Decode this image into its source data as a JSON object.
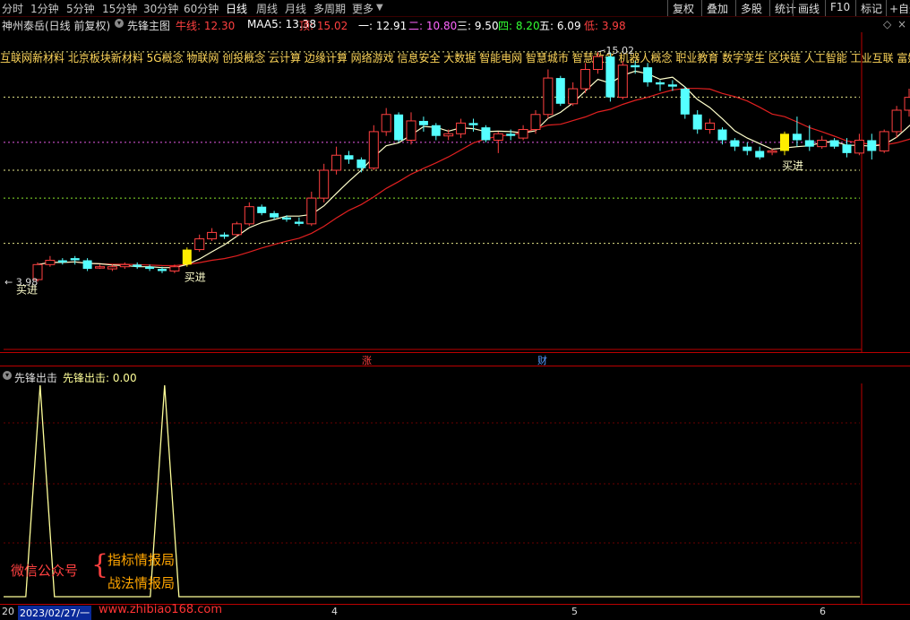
{
  "toolbar": {
    "periods": [
      "分时",
      "1分钟",
      "5分钟",
      "15分钟",
      "30分钟",
      "60分钟",
      "日线",
      "周线",
      "月线",
      "多周期",
      "更多"
    ],
    "active_period": "日线",
    "right_buttons": [
      "复权",
      "叠加",
      "多股",
      "统计",
      "画线",
      "F10",
      "标记",
      "+自选"
    ]
  },
  "info": {
    "stock": "神州泰岳(日线 前复权)",
    "main_indicator": "先锋主图",
    "niu_label": "牛线: 12.30",
    "maa5_label": "MAA5: 13.38",
    "ding_label": "顶: 15.02",
    "yi_label": "一: 12.91",
    "er_label": "二: 10.80",
    "san_label": "三: 9.50",
    "si_label": "四: 8.20",
    "wu_label": "五: 6.09",
    "di_label": "低: 3.98",
    "colors": {
      "niu": "#ff4040",
      "maa5": "#ffffff",
      "ding": "#ff4040",
      "yi": "#ffffff",
      "er": "#ff66ff",
      "san": "#ffffff",
      "si": "#33ff33",
      "wu": "#ffffff",
      "di": "#ff4040"
    }
  },
  "concepts": "互联网新材料 北京板块新材料 5G概念 物联网 创投概念 云计算 边缘计算 网络游戏 信息安全 大数据 智能电网 智慧城市 智慧政务 机器人概念 职业教育 数字孪生 区块链 人工智能 工业互联 富媒",
  "main_chart": {
    "max_label": "15.02",
    "min_label": "3.98",
    "buy_label": "买进",
    "level_lines": [
      {
        "price": 15.02,
        "color": "#ffff99"
      },
      {
        "price": 12.91,
        "color": "#ffff99"
      },
      {
        "price": 10.8,
        "color": "#ff66ff"
      },
      {
        "price": 9.5,
        "color": "#ffff99"
      },
      {
        "price": 8.2,
        "color": "#99ff33"
      },
      {
        "price": 6.09,
        "color": "#ffff99"
      }
    ],
    "candles": [
      [
        4.4,
        5.1,
        4.3,
        5.2
      ],
      [
        5.1,
        5.3,
        5.0,
        5.5
      ],
      [
        5.3,
        5.2,
        5.1,
        5.4
      ],
      [
        5.4,
        5.3,
        5.1,
        5.5
      ],
      [
        5.3,
        4.9,
        4.8,
        5.4
      ],
      [
        5.0,
        5.0,
        4.9,
        5.1
      ],
      [
        4.9,
        5.0,
        4.8,
        5.1
      ],
      [
        5.0,
        5.1,
        4.9,
        5.2
      ],
      [
        5.1,
        5.0,
        4.9,
        5.2
      ],
      [
        5.0,
        4.9,
        4.8,
        5.1
      ],
      [
        4.9,
        4.8,
        4.7,
        5.0
      ],
      [
        4.8,
        5.0,
        4.7,
        5.1
      ],
      [
        5.1,
        5.8,
        5.0,
        5.9
      ],
      [
        5.8,
        6.3,
        5.7,
        6.5
      ],
      [
        6.3,
        6.6,
        6.2,
        6.8
      ],
      [
        6.5,
        6.4,
        6.3,
        6.6
      ],
      [
        6.5,
        7.0,
        6.4,
        7.1
      ],
      [
        7.0,
        7.8,
        6.9,
        8.0
      ],
      [
        7.8,
        7.5,
        7.4,
        7.9
      ],
      [
        7.5,
        7.3,
        7.2,
        7.6
      ],
      [
        7.3,
        7.2,
        7.1,
        7.4
      ],
      [
        7.1,
        7.0,
        6.9,
        7.3
      ],
      [
        7.0,
        8.2,
        6.9,
        8.5
      ],
      [
        8.2,
        9.5,
        8.0,
        9.8
      ],
      [
        9.5,
        10.2,
        9.3,
        10.6
      ],
      [
        10.2,
        10.0,
        9.8,
        10.4
      ],
      [
        10.0,
        9.6,
        9.4,
        10.1
      ],
      [
        9.6,
        11.3,
        9.5,
        11.6
      ],
      [
        11.3,
        12.1,
        11.1,
        12.4
      ],
      [
        12.1,
        10.9,
        10.8,
        12.2
      ],
      [
        10.9,
        11.8,
        10.7,
        12.2
      ],
      [
        11.8,
        11.6,
        11.3,
        12.0
      ],
      [
        11.6,
        11.1,
        10.9,
        11.7
      ],
      [
        11.1,
        11.2,
        10.9,
        11.4
      ],
      [
        11.2,
        11.7,
        11.0,
        11.9
      ],
      [
        11.7,
        11.6,
        11.3,
        11.9
      ],
      [
        11.5,
        10.9,
        10.8,
        11.6
      ],
      [
        10.9,
        11.2,
        10.3,
        11.3
      ],
      [
        11.2,
        11.1,
        10.9,
        11.4
      ],
      [
        11.0,
        11.4,
        10.9,
        11.6
      ],
      [
        11.4,
        12.1,
        11.2,
        12.3
      ],
      [
        12.1,
        13.8,
        11.9,
        14.2
      ],
      [
        13.8,
        12.6,
        12.5,
        13.9
      ],
      [
        12.6,
        13.3,
        12.5,
        13.6
      ],
      [
        13.3,
        14.2,
        13.1,
        14.5
      ],
      [
        14.2,
        14.8,
        14.0,
        15.02
      ],
      [
        14.8,
        12.9,
        12.7,
        15.0
      ],
      [
        12.9,
        14.4,
        12.8,
        14.6
      ],
      [
        14.4,
        14.3,
        14.0,
        14.6
      ],
      [
        14.3,
        13.6,
        13.4,
        14.5
      ],
      [
        13.6,
        13.5,
        13.2,
        13.7
      ],
      [
        13.5,
        13.4,
        13.2,
        13.7
      ],
      [
        13.3,
        12.1,
        11.9,
        13.4
      ],
      [
        12.1,
        11.4,
        11.2,
        12.3
      ],
      [
        11.4,
        11.7,
        11.2,
        11.9
      ],
      [
        11.4,
        10.9,
        10.7,
        11.5
      ],
      [
        10.9,
        10.6,
        10.4,
        11.0
      ],
      [
        10.6,
        10.4,
        10.2,
        10.8
      ],
      [
        10.4,
        10.1,
        10.0,
        10.6
      ],
      [
        10.4,
        10.4,
        10.2,
        10.5
      ],
      [
        10.4,
        11.2,
        10.2,
        11.3
      ],
      [
        11.2,
        10.9,
        10.6,
        12.0
      ],
      [
        10.9,
        10.6,
        10.4,
        11.6
      ],
      [
        10.6,
        10.9,
        10.5,
        11.1
      ],
      [
        10.9,
        10.6,
        10.5,
        11.0
      ],
      [
        10.7,
        10.3,
        10.1,
        11.0
      ],
      [
        10.3,
        10.9,
        10.2,
        11.2
      ],
      [
        10.9,
        10.4,
        10.0,
        11.2
      ],
      [
        10.4,
        11.3,
        10.3,
        11.4
      ],
      [
        11.3,
        12.3,
        11.0,
        12.5
      ],
      [
        12.3,
        12.9,
        12.0,
        13.3
      ],
      [
        12.9,
        13.6,
        12.7,
        14.0
      ],
      [
        13.6,
        13.5,
        13.3,
        13.8
      ],
      [
        13.5,
        13.4,
        13.2,
        14.0
      ],
      [
        13.4,
        12.9,
        12.8,
        13.6
      ],
      [
        12.9,
        13.6,
        12.8,
        13.8
      ],
      [
        13.6,
        13.7,
        13.4,
        13.9
      ]
    ],
    "buy_candles": [
      12,
      60
    ]
  },
  "sub": {
    "title": "先锋出击",
    "label": "先锋出击: 0.00",
    "peaks": [
      2,
      12
    ]
  },
  "axis": {
    "date_label": "2023/02/27/一",
    "month_labels": [
      "4",
      "5",
      "6"
    ],
    "zhang": "涨",
    "cai": "财"
  },
  "watermark": {
    "left": "微信公众号",
    "right_top": "指标情报局",
    "right_bottom": "战法情报局",
    "url": "www.zhibiao168.com"
  }
}
